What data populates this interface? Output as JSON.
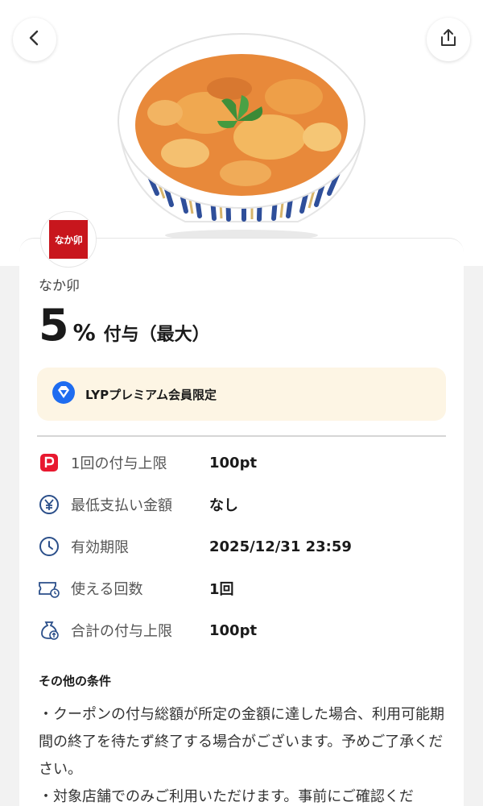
{
  "header": {
    "back_icon": "chevron-left-icon",
    "share_icon": "share-upload-icon"
  },
  "shop": {
    "logo_text": "なか卯",
    "name": "なか卯"
  },
  "reward": {
    "value": "5",
    "unit": "%",
    "label": "付与（最大）"
  },
  "premium": {
    "icon": "lyp-diamond-icon",
    "label": "LYPプレミアム会員限定",
    "accent": "#1e6cf0"
  },
  "details": [
    {
      "icon": "paypay-p-icon",
      "label": "1回の付与上限",
      "value": "100pt"
    },
    {
      "icon": "yen-circle-icon",
      "label": "最低支払い金額",
      "value": "なし"
    },
    {
      "icon": "clock-icon",
      "label": "有効期限",
      "value": "2025/12/31 23:59"
    },
    {
      "icon": "ticket-clock-icon",
      "label": "使える回数",
      "value": "1回"
    },
    {
      "icon": "money-bag-up-icon",
      "label": "合計の付与上限",
      "value": "100pt"
    }
  ],
  "terms": {
    "title": "その他の条件",
    "lines": [
      "・クーポンの付与総額が所定の金額に達した場合、利用可能期間の終了を待たず終了する場合がございます。予めご了承ください。",
      "・対象店舗でのみご利用いただけます。事前にご確認くだ"
    ]
  },
  "colors": {
    "brand_red": "#c8161d",
    "premium_bg": "#fdf5e4",
    "icon_blue": "#2b4f8a",
    "paypay_red": "#e8182f"
  }
}
